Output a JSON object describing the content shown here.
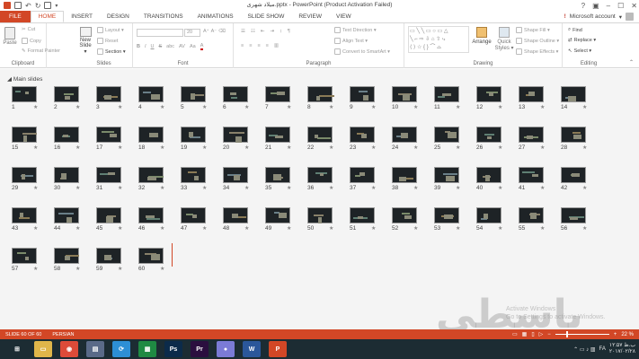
{
  "titlebar": {
    "title": "میلاد شهری.pptx - PowerPoint (Product Activation Failed)",
    "controls": [
      "?",
      "▣",
      "–",
      "☐",
      "✕"
    ]
  },
  "tabs": [
    {
      "label": "FILE"
    },
    {
      "label": "HOME"
    },
    {
      "label": "INSERT"
    },
    {
      "label": "DESIGN"
    },
    {
      "label": "TRANSITIONS"
    },
    {
      "label": "ANIMATIONS"
    },
    {
      "label": "SLIDE SHOW"
    },
    {
      "label": "REVIEW"
    },
    {
      "label": "VIEW"
    }
  ],
  "account": {
    "warning": "!",
    "label": "Microsoft account",
    "chevron": "▾"
  },
  "ribbon": {
    "clipboard": {
      "paste": "Paste",
      "cut": "Cut",
      "copy": "Copy",
      "format_painter": "Format Painter",
      "label": "Clipboard"
    },
    "slides": {
      "new_slide": "New",
      "new_slide2": "Slide ▾",
      "layout": "Layout ▾",
      "reset": "Reset",
      "section": "Section ▾",
      "label": "Slides"
    },
    "font": {
      "label": "Font",
      "size": "20",
      "bold": "B",
      "italic": "I",
      "underline": "U",
      "strike": "S",
      "shadow": "abc",
      "spacing": "AV",
      "case": "Aa",
      "color": "A"
    },
    "paragraph": {
      "label": "Paragraph",
      "text_direction": "Text Direction ▾",
      "align_text": "Align Text ▾",
      "smartart": "Convert to SmartArt ▾"
    },
    "drawing": {
      "label": "Drawing",
      "arrange": "Arrange",
      "quick_styles": "Quick",
      "quick_styles2": "Styles ▾",
      "shape_fill": "Shape Fill ▾",
      "shape_outline": "Shape Outline ▾",
      "shape_effects": "Shape Effects ▾"
    },
    "editing": {
      "label": "Editing",
      "find": "Find",
      "replace": "Replace ▾",
      "select": "Select ▾"
    }
  },
  "panel": {
    "section_title": "Main slides",
    "slide_star": "★",
    "slides": [
      "1",
      "2",
      "3",
      "4",
      "5",
      "6",
      "7",
      "8",
      "9",
      "10",
      "11",
      "12",
      "13",
      "14",
      "15",
      "16",
      "17",
      "18",
      "19",
      "20",
      "21",
      "22",
      "23",
      "24",
      "25",
      "26",
      "27",
      "28",
      "29",
      "30",
      "31",
      "32",
      "33",
      "34",
      "35",
      "36",
      "37",
      "38",
      "39",
      "40",
      "41",
      "42",
      "43",
      "44",
      "45",
      "46",
      "47",
      "48",
      "49",
      "50",
      "51",
      "52",
      "53",
      "54",
      "55",
      "56",
      "57",
      "58",
      "59",
      "60"
    ]
  },
  "watermark": {
    "logo_text": "باسطی",
    "activation_line1": "Activate Windows",
    "activation_line2": "Go to Settings to activate Windows."
  },
  "statusbar": {
    "slide_info": "SLIDE 60 OF 60",
    "language": "PERSIAN",
    "zoom": "22 %",
    "minus": "−",
    "plus": "+"
  },
  "taskbar": {
    "apps": [
      {
        "label": "⊞",
        "color": "#1c2c33"
      },
      {
        "label": "▭",
        "color": "#e0b64a"
      },
      {
        "label": "◉",
        "color": "#dd4b39"
      },
      {
        "label": "▤",
        "color": "#5a6a88"
      },
      {
        "label": "⟳",
        "color": "#2d8fd5"
      },
      {
        "label": "▦",
        "color": "#1f8a43"
      },
      {
        "label": "Ps",
        "color": "#0c2b4a"
      },
      {
        "label": "Pr",
        "color": "#2b0f3f"
      },
      {
        "label": "●",
        "color": "#7b7bd6"
      },
      {
        "label": "W",
        "color": "#2b579a"
      },
      {
        "label": "P",
        "color": "#d24726"
      }
    ],
    "lang": "FA",
    "time": "۱۲:۵۷ ب.ظ",
    "date": "۲۰۱۷/۰۲/۲۸",
    "tray_icons": "⌃ ▭ ♪ ▥"
  }
}
